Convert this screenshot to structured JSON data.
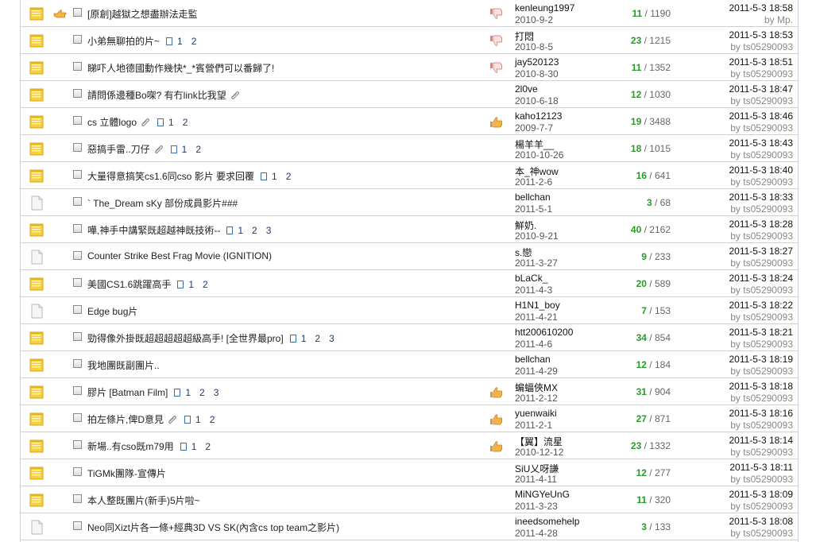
{
  "colors": {
    "accent_green": "#2a9a2a",
    "border": "#c8d3dd",
    "folder_hot": "#f6cf3e"
  },
  "threads": [
    {
      "title": "[原創]越獄之想盡辦法走監",
      "pages": [],
      "clip": false,
      "author": "kenleung1997",
      "date": "2010-9-2",
      "replies": "11",
      "views": "1190",
      "last_time": "2011-5-3 18:58",
      "last_by": "Mp.",
      "by_prefix": "by",
      "folder": "hot",
      "hand": true,
      "rate": "thumb-down"
    },
    {
      "title": "小弟無聊拍的片~",
      "pages": [
        "1",
        "2"
      ],
      "clip": false,
      "author": "打悶",
      "date": "2010-8-5",
      "replies": "23",
      "views": "1215",
      "last_time": "2011-5-3 18:53",
      "last_by": "ts05290093",
      "by_prefix": "by",
      "folder": "hot",
      "hand": false,
      "rate": "thumb-down"
    },
    {
      "title": "睇吓人地德國動作幾快*_*賓營們可以番歸了!",
      "pages": [],
      "clip": false,
      "author": "jay520123",
      "date": "2010-8-30",
      "replies": "11",
      "views": "1352",
      "last_time": "2011-5-3 18:51",
      "last_by": "ts05290093",
      "by_prefix": "by",
      "folder": "hot",
      "hand": false,
      "rate": "thumb-down"
    },
    {
      "title": "請問係邊種Bo㗎? 有冇link比我望",
      "pages": [],
      "clip": true,
      "author": "2l0ve",
      "date": "2010-6-18",
      "replies": "12",
      "views": "1030",
      "last_time": "2011-5-3 18:47",
      "last_by": "ts05290093",
      "by_prefix": "by",
      "folder": "hot",
      "hand": false,
      "rate": ""
    },
    {
      "title": "cs 立體logo",
      "pages": [
        "1",
        "2"
      ],
      "clip": true,
      "author": "kaho12123",
      "date": "2009-7-7",
      "replies": "19",
      "views": "3488",
      "last_time": "2011-5-3 18:46",
      "last_by": "ts05290093",
      "by_prefix": "by",
      "folder": "hot",
      "hand": false,
      "rate": "thumb-up"
    },
    {
      "title": "惡搞手雷..刀仔",
      "pages": [
        "1",
        "2"
      ],
      "clip": true,
      "author": "楊羊羊__",
      "date": "2010-10-26",
      "replies": "18",
      "views": "1015",
      "last_time": "2011-5-3 18:43",
      "last_by": "ts05290093",
      "by_prefix": "by",
      "folder": "hot",
      "hand": false,
      "rate": ""
    },
    {
      "title": "大量得意搞笑cs1.6同cso 影片 要求回覆",
      "pages": [
        "1",
        "2"
      ],
      "clip": false,
      "author": "本_神wow",
      "date": "2011-2-6",
      "replies": "16",
      "views": "641",
      "last_time": "2011-5-3 18:40",
      "last_by": "ts05290093",
      "by_prefix": "by",
      "folder": "hot",
      "hand": false,
      "rate": ""
    },
    {
      "title": "` The_Dream sKy 部份成員影片###",
      "pages": [],
      "clip": false,
      "author": "bellchan",
      "date": "2011-5-1",
      "replies": "3",
      "views": "68",
      "last_time": "2011-5-3 18:33",
      "last_by": "ts05290093",
      "by_prefix": "by",
      "folder": "normal",
      "hand": false,
      "rate": ""
    },
    {
      "title": "嘩,神手中講緊既超越神既技術--",
      "pages": [
        "1",
        "2",
        "3"
      ],
      "clip": false,
      "author": "鮮奶.",
      "date": "2010-9-21",
      "replies": "40",
      "views": "2162",
      "last_time": "2011-5-3 18:28",
      "last_by": "ts05290093",
      "by_prefix": "by",
      "folder": "hot",
      "hand": false,
      "rate": ""
    },
    {
      "title": "Counter Strike Best Frag Movie (IGNITION)",
      "pages": [],
      "clip": false,
      "author": "s.戀",
      "date": "2011-3-27",
      "replies": "9",
      "views": "233",
      "last_time": "2011-5-3 18:27",
      "last_by": "ts05290093",
      "by_prefix": "by",
      "folder": "normal",
      "hand": false,
      "rate": ""
    },
    {
      "title": "美國CS1.6跳躍高手",
      "pages": [
        "1",
        "2"
      ],
      "clip": false,
      "author": "bLaCk_",
      "date": "2011-4-3",
      "replies": "20",
      "views": "589",
      "last_time": "2011-5-3 18:24",
      "last_by": "ts05290093",
      "by_prefix": "by",
      "folder": "hot",
      "hand": false,
      "rate": ""
    },
    {
      "title": "Edge bug片",
      "pages": [],
      "clip": false,
      "author": "H1N1_boy",
      "date": "2011-4-21",
      "replies": "7",
      "views": "153",
      "last_time": "2011-5-3 18:22",
      "last_by": "ts05290093",
      "by_prefix": "by",
      "folder": "normal",
      "hand": false,
      "rate": ""
    },
    {
      "title": "勁得像外掛既超超超超超級高手! [全世界最pro]",
      "pages": [
        "1",
        "2",
        "3"
      ],
      "clip": false,
      "author": "htt200610200",
      "date": "2011-4-6",
      "replies": "34",
      "views": "854",
      "last_time": "2011-5-3 18:21",
      "last_by": "ts05290093",
      "by_prefix": "by",
      "folder": "hot",
      "hand": false,
      "rate": ""
    },
    {
      "title": "我地團既副團片..",
      "pages": [],
      "clip": false,
      "author": "bellchan",
      "date": "2011-4-29",
      "replies": "12",
      "views": "184",
      "last_time": "2011-5-3 18:19",
      "last_by": "ts05290093",
      "by_prefix": "by",
      "folder": "hot",
      "hand": false,
      "rate": ""
    },
    {
      "title": "膠片 [Batman Film]",
      "pages": [
        "1",
        "2",
        "3"
      ],
      "clip": false,
      "author": "蝙蝠俠MX",
      "date": "2011-2-12",
      "replies": "31",
      "views": "904",
      "last_time": "2011-5-3 18:18",
      "last_by": "ts05290093",
      "by_prefix": "by",
      "folder": "hot",
      "hand": false,
      "rate": "thumb-up"
    },
    {
      "title": "拍左條片,俾D意見",
      "pages": [
        "1",
        "2"
      ],
      "clip": true,
      "author": "yuenwaiki",
      "date": "2011-2-1",
      "replies": "27",
      "views": "871",
      "last_time": "2011-5-3 18:16",
      "last_by": "ts05290093",
      "by_prefix": "by",
      "folder": "hot",
      "hand": false,
      "rate": "thumb-up"
    },
    {
      "title": "新場..有cso既m79用",
      "pages": [
        "1",
        "2"
      ],
      "clip": false,
      "author": "【翼】流星",
      "date": "2010-12-12",
      "replies": "23",
      "views": "1332",
      "last_time": "2011-5-3 18:14",
      "last_by": "ts05290093",
      "by_prefix": "by",
      "folder": "hot",
      "hand": false,
      "rate": "thumb-up"
    },
    {
      "title": "TiGMk團隊-宣傳片",
      "pages": [],
      "clip": false,
      "author": "SiU乂呀謙",
      "date": "2011-4-11",
      "replies": "12",
      "views": "277",
      "last_time": "2011-5-3 18:11",
      "last_by": "ts05290093",
      "by_prefix": "by",
      "folder": "hot",
      "hand": false,
      "rate": ""
    },
    {
      "title": "本人整既團片(新手)5片啦~",
      "pages": [],
      "clip": false,
      "author": "MiNGYeUnG",
      "date": "2011-3-23",
      "replies": "11",
      "views": "320",
      "last_time": "2011-5-3 18:09",
      "last_by": "ts05290093",
      "by_prefix": "by",
      "folder": "hot",
      "hand": false,
      "rate": ""
    },
    {
      "title": "Neo同Xizt片各一條+經典3D VS SK(內含cs top team之影片)",
      "pages": [],
      "clip": false,
      "author": "ineedsomehelp",
      "date": "2011-4-28",
      "replies": "3",
      "views": "133",
      "last_time": "2011-5-3 18:08",
      "last_by": "ts05290093",
      "by_prefix": "by",
      "folder": "normal",
      "hand": false,
      "rate": ""
    }
  ]
}
